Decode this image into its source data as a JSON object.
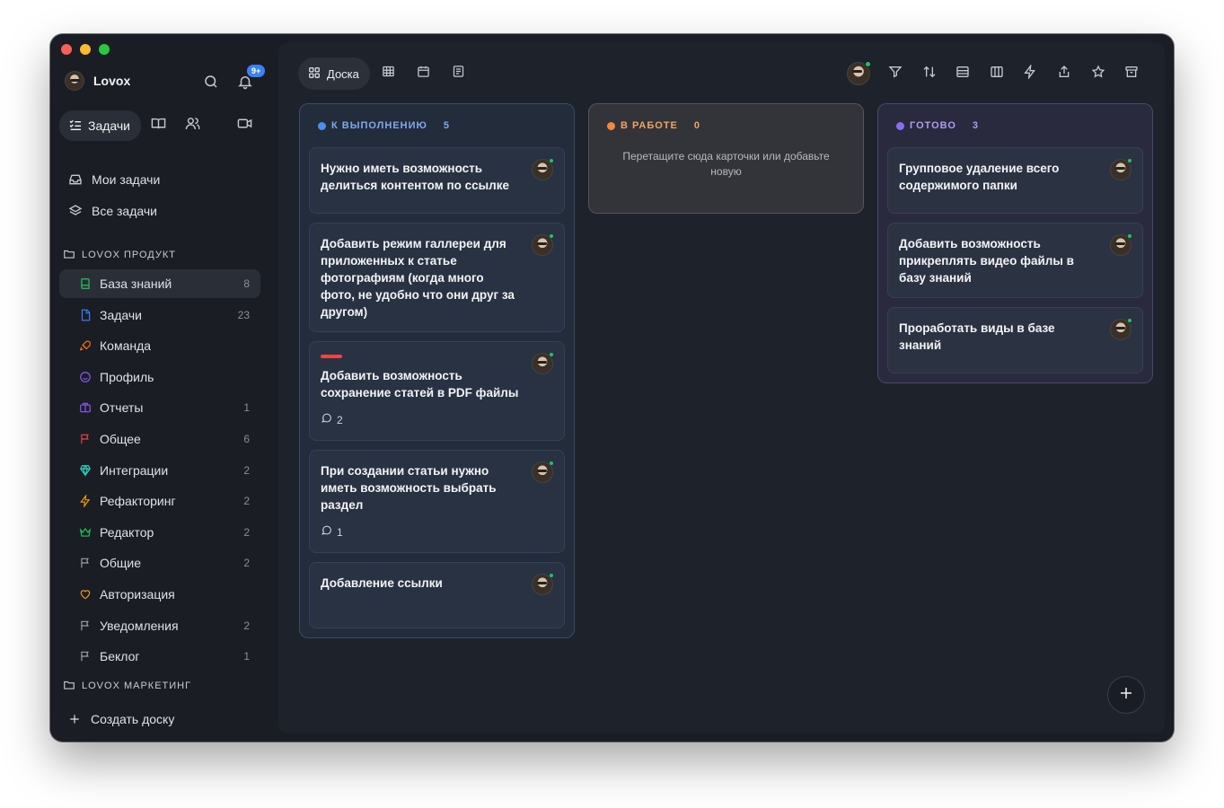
{
  "sidebar": {
    "brand": "Lovox",
    "notifications_badge": "9+",
    "modes": {
      "active_label": "Задачи"
    },
    "nav": [
      {
        "label": "Мои задачи"
      },
      {
        "label": "Все задачи"
      }
    ],
    "section_product": "LOVOX ПРОДУКТ",
    "projects": [
      {
        "label": "База знаний",
        "count": "8",
        "icon": "book-icon",
        "color": "#22c55e"
      },
      {
        "label": "Задачи",
        "count": "23",
        "icon": "file-icon",
        "color": "#3b82f6"
      },
      {
        "label": "Команда",
        "count": "",
        "icon": "rocket-icon",
        "color": "#f97316"
      },
      {
        "label": "Профиль",
        "count": "",
        "icon": "smile-icon",
        "color": "#8b5cf6"
      },
      {
        "label": "Отчеты",
        "count": "1",
        "icon": "briefcase-icon",
        "color": "#8b5cf6"
      },
      {
        "label": "Общее",
        "count": "6",
        "icon": "flag-icon",
        "color": "#ef4444"
      },
      {
        "label": "Интеграции",
        "count": "2",
        "icon": "diamond-icon",
        "color": "#2dd4bf"
      },
      {
        "label": "Рефакторинг",
        "count": "2",
        "icon": "bolt-icon",
        "color": "#f59e0b"
      },
      {
        "label": "Редактор",
        "count": "2",
        "icon": "crown-icon",
        "color": "#22c55e"
      },
      {
        "label": "Общие",
        "count": "2",
        "icon": "flag-icon",
        "color": "#9ca3af"
      },
      {
        "label": "Авторизация",
        "count": "",
        "icon": "heart-icon",
        "color": "#f59e0b"
      },
      {
        "label": "Уведомления",
        "count": "2",
        "icon": "flag-icon",
        "color": "#9ca3af"
      },
      {
        "label": "Беклог",
        "count": "1",
        "icon": "flag-icon",
        "color": "#9ca3af"
      }
    ],
    "section_marketing": "LOVOX МАРКЕТИНГ",
    "create_board": "Создать доску"
  },
  "toolbar": {
    "active_view": "Доска"
  },
  "columns": {
    "todo": {
      "title": "К ВЫПОЛНЕНИЮ",
      "count": "5",
      "color": "#4a8ef0",
      "cards": [
        {
          "title": "Нужно иметь возможность делиться контентом по ссылке"
        },
        {
          "title": "Добавить режим галлереи для приложенных к статье фотографиям (когда много фото, не удобно что они друг за другом)"
        },
        {
          "title": "Добавить возможность сохранение статей в PDF файлы",
          "comments": "2"
        },
        {
          "title": "При создании статьи нужно иметь возможность выбрать раздел",
          "comments": "1"
        },
        {
          "title": "Добавление ссылки"
        }
      ]
    },
    "work": {
      "title": "В РАБОТЕ",
      "count": "0",
      "color": "#f08a3c",
      "empty": "Перетащите сюда карточки или добавьте новую"
    },
    "done": {
      "title": "ГОТОВО",
      "count": "3",
      "color": "#8b6cf0",
      "cards": [
        {
          "title": "Групповое удаление всего содержимого папки"
        },
        {
          "title": "Добавить возможность прикреплять видео файлы в базу знаний"
        },
        {
          "title": "Проработать виды в базе знаний"
        }
      ]
    }
  }
}
